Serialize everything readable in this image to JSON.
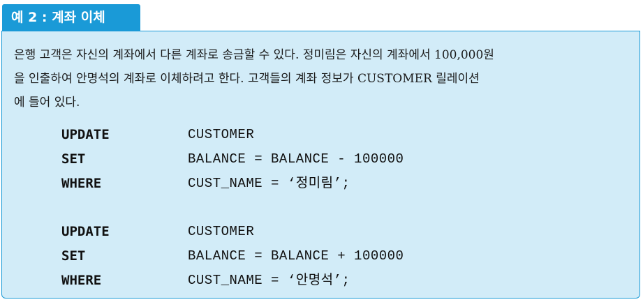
{
  "header": {
    "title": "예 2 : 계좌 이체"
  },
  "description": {
    "lines": [
      "은행 고객은 자신의 계좌에서 다른 계좌로 송금할 수 있다. 정미림은 자신의 계좌에서 100,000원",
      "을 인출하여 안명석의 계좌로 이체하려고 한다. 고객들의 계좌 정보가 CUSTOMER 릴레이션",
      "에 들어 있다."
    ]
  },
  "code_blocks": [
    {
      "lines": [
        {
          "keyword": "UPDATE",
          "text": "CUSTOMER"
        },
        {
          "keyword": "SET",
          "text": "BALANCE = BALANCE - 100000"
        },
        {
          "keyword": "WHERE",
          "text": "CUST_NAME = ‘정미림’;"
        }
      ]
    },
    {
      "lines": [
        {
          "keyword": "UPDATE",
          "text": "CUSTOMER"
        },
        {
          "keyword": "SET",
          "text": "BALANCE = BALANCE + 100000"
        },
        {
          "keyword": "WHERE",
          "text": "CUST_NAME = ‘안명석’;"
        }
      ]
    }
  ],
  "colors": {
    "accent": "#1a9ad7",
    "box_background": "#d2ecf8"
  }
}
